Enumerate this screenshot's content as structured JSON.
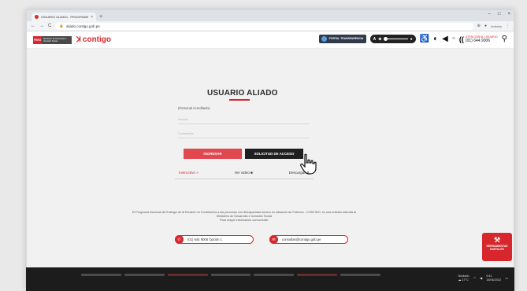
{
  "browser": {
    "tab_title": "USUARIO ALIADO - PROGRAMA",
    "tab_close": "×",
    "new_tab": "+",
    "window_controls": [
      "–",
      "□",
      "×"
    ],
    "nav_icons": [
      "←",
      "→",
      "C"
    ],
    "url": "aliado.contigo.gob.pe",
    "profile_label": "Invitado"
  },
  "header": {
    "peru_label": "PERÚ",
    "ministry_label": "Ministerio de Desarrollo e Inclusión Social",
    "brand": "contigo",
    "portal_label": "PORTAL TRANSPARENCIA",
    "zoom_minus": "A",
    "zoom_plus": "A",
    "phone_title": "ATENCIÓN AL USUARIO",
    "phone_number": "(01) 644 9006",
    "icons": [
      "portal-icon",
      "zoom-in-icon",
      "zoom-out-icon",
      "accessibility-icon",
      "contrast-icon",
      "audio-icon",
      "phone-icon",
      "search-icon"
    ]
  },
  "login": {
    "title": "USUARIO ALIADO",
    "subtitle": "(Personal Acreditado)",
    "user_placeholder": "Usuario",
    "password_placeholder": "Contraseña",
    "login_button": "INGRESAR",
    "request_button": "SOLICITUD DE ACCESO"
  },
  "links": {
    "instructions": "Instructivo »",
    "video": "Ver video ■",
    "download": "Descargar ⬇"
  },
  "footer": {
    "disclaimer_1": "El Programa Nacional de Entrega de la Pensión no Contributiva a las personas con discapacidad severa en situación de Pobreza - CONTIGO, es una entidad adscrita al",
    "disclaimer_2": "Ministerio de Desarrollo e Inclusión Social",
    "disclaimer_3": "Para mayor información comunícate:",
    "phone_pill": "(01) 644 9006 Opción 1",
    "email_pill": "consultas@contigo.gob.pe",
    "tools_button": "HERRAMIENTAS DIGITALES"
  },
  "taskbar": {
    "weather": "Nublado",
    "temperature": "17°C",
    "time": "9:41",
    "date": "15/06/2022"
  }
}
